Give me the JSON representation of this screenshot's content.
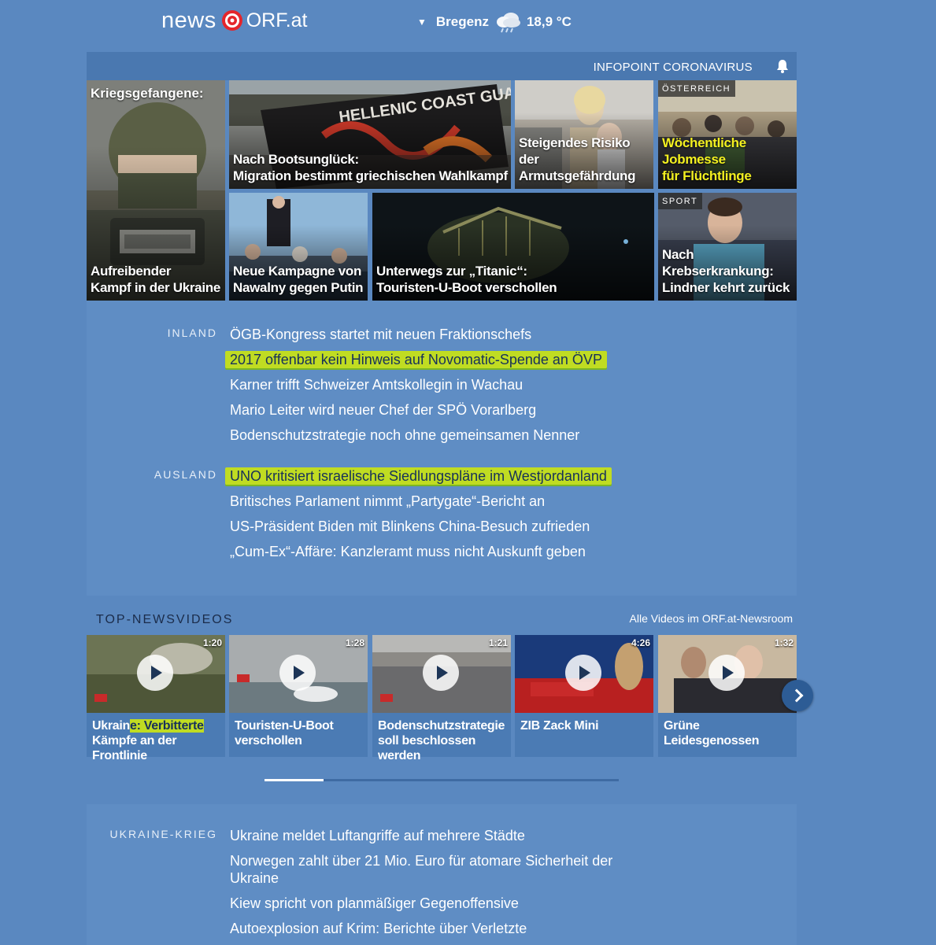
{
  "header": {
    "logo_news": "news",
    "logo_orf": "ORF.at",
    "weather_location": "Bregenz",
    "weather_temp": "18,9 °C",
    "weather_icon": "rain-cloud-icon"
  },
  "topbar": {
    "corona_link": "INFOPOINT CORONAVIRUS",
    "bell_icon": "bell-icon"
  },
  "tiles": {
    "t1": {
      "top_caption": "Kriegsgefangene:",
      "caption": [
        "Aufreibender",
        "Kampf in der Ukraine"
      ]
    },
    "t2": {
      "caption": [
        "Nach Bootsunglück:",
        "Migration bestimmt griechischen Wahlkampf"
      ]
    },
    "t3": {
      "caption": [
        "Steigendes Risiko",
        "der Armutsgefährdung"
      ]
    },
    "t4": {
      "kicker": "ÖSTERREICH",
      "caption": [
        "Wöchentliche Jobmesse",
        "für Flüchtlinge"
      ]
    },
    "t5": {
      "caption": [
        "Neue Kampagne von",
        "Nawalny gegen Putin"
      ]
    },
    "t6": {
      "caption": [
        "Unterwegs zur „Titanic“:",
        "Touristen-U-Boot verschollen"
      ]
    },
    "t7": {
      "kicker": "SPORT",
      "caption": [
        "Nach Krebserkrankung:",
        "Lindner kehrt zurück"
      ]
    }
  },
  "inland": {
    "label": "INLAND",
    "items": [
      "ÖGB-Kongress startet mit neuen Fraktionschefs",
      "2017 offenbar kein Hinweis auf Novomatic-Spende an ÖVP",
      "Karner trifft Schweizer Amtskollegin in Wachau",
      "Mario Leiter wird neuer Chef der SPÖ Vorarlberg",
      "Bodenschutzstrategie noch ohne gemeinsamen Nenner"
    ]
  },
  "ausland": {
    "label": "AUSLAND",
    "items": [
      "UNO kritisiert israelische Siedlungspläne im Westjordanland",
      "Britisches Parlament nimmt „Partygate“-Bericht an",
      "US-Präsident Biden mit Blinkens China-Besuch zufrieden",
      "„Cum-Ex“-Affäre: Kanzleramt muss nicht Auskunft geben"
    ]
  },
  "videos": {
    "title": "TOP-NEWSVIDEOS",
    "all_link": "Alle Videos im ORF.at-Newsroom",
    "items": [
      {
        "duration": "1:20",
        "cap_a": "Ukrain",
        "cap_hl": "e: Verbitterte",
        "cap_b": "Kämpfe an der Frontlinie"
      },
      {
        "duration": "1:28",
        "cap_a": "Touristen-U-Boot",
        "cap_b": "verschollen"
      },
      {
        "duration": "1:21",
        "cap_a": "Bodenschutzstrategie",
        "cap_b": "soll beschlossen werden"
      },
      {
        "duration": "4:26",
        "cap_a": "ZIB Zack Mini",
        "cap_b": ""
      },
      {
        "duration": "1:32",
        "cap_a": "Grüne Leidesgenossen",
        "cap_b": ""
      }
    ]
  },
  "ukraine": {
    "label": "UKRAINE-KRIEG",
    "items": [
      "Ukraine meldet Luftangriffe auf mehrere Städte",
      "Norwegen zahlt über 21 Mio. Euro für atomare Sicherheit der Ukraine",
      "Kiew spricht von planmäßiger Gegenoffensive",
      "Autoexplosion auf Krim: Berichte über Verletzte"
    ]
  }
}
